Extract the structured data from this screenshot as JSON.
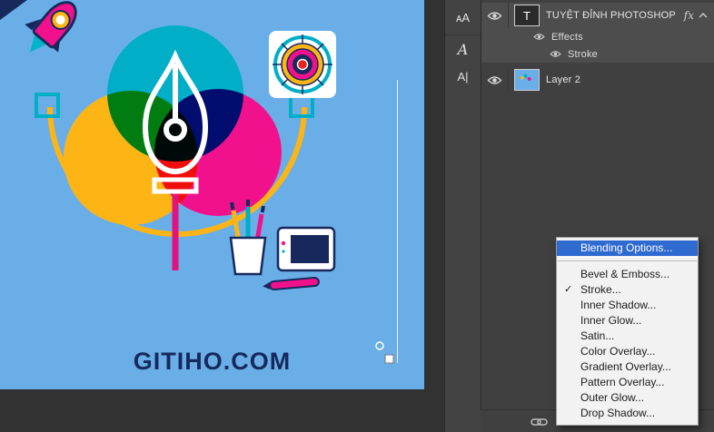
{
  "canvas": {
    "brand_text": "GITIHO.COM"
  },
  "dock": {
    "icons": [
      {
        "name": "character-panel",
        "glyph": "ᴀA"
      },
      {
        "name": "glyphs-panel",
        "glyph": "A"
      },
      {
        "name": "paragraph-styles-panel",
        "glyph": "A|"
      }
    ]
  },
  "layers": {
    "rows": [
      {
        "type": "text-layer",
        "thumb_glyph": "T",
        "label": "TUYỆT ĐỈNH PHOTOSHOP",
        "fx_badge": "fx",
        "selected": true
      },
      {
        "type": "effects-group",
        "label": "Effects",
        "selected": true
      },
      {
        "type": "effect-item",
        "label": "Stroke",
        "selected": true
      },
      {
        "type": "image-layer",
        "label": "Layer 2",
        "selected": false
      }
    ]
  },
  "context_menu": {
    "check_glyph": "✓",
    "items": [
      {
        "label": "Blending Options...",
        "highlighted": true
      },
      {
        "label": "Bevel & Emboss..."
      },
      {
        "label": "Stroke...",
        "checked": true
      },
      {
        "label": "Inner Shadow..."
      },
      {
        "label": "Inner Glow..."
      },
      {
        "label": "Satin..."
      },
      {
        "label": "Color Overlay..."
      },
      {
        "label": "Gradient Overlay..."
      },
      {
        "label": "Pattern Overlay..."
      },
      {
        "label": "Outer Glow..."
      },
      {
        "label": "Drop Shadow..."
      }
    ]
  },
  "colors": {
    "canvas_blue": "#6aaee8",
    "teal": "#00aec8",
    "yellow": "#fdb515",
    "magenta": "#f2118c",
    "navy": "#17295c",
    "menu_highlight": "#2f6ad1",
    "panel_bg": "#404040",
    "selected_row_bg": "#4d4d4d"
  }
}
